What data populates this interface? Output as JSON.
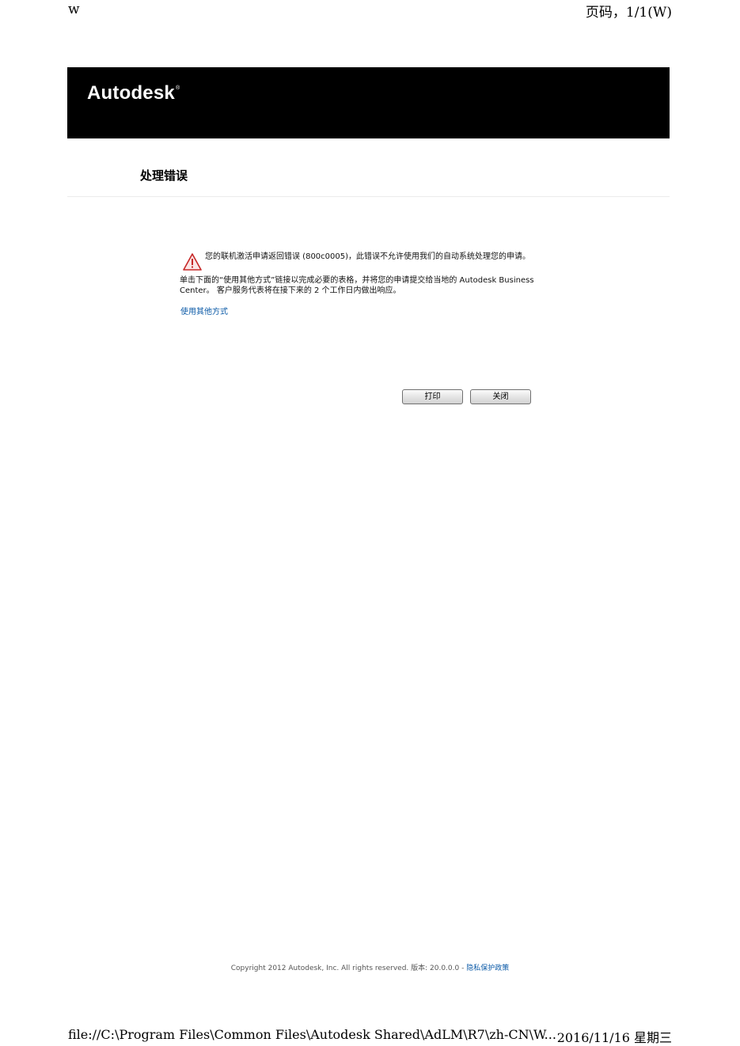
{
  "print_header": {
    "left": "w",
    "right": "页码，1/1(W)"
  },
  "banner": {
    "logo_text": "Autodesk",
    "logo_mark": "®",
    "background_color": "#000000"
  },
  "page": {
    "title": "处理错误"
  },
  "message": {
    "icon": "warning-triangle-icon",
    "line1": "您的联机激活申请返回错误 (800c0005)，此错误不允许使用我们的自动系统处理您的申请。",
    "line2": "单击下面的“使用其他方式”链接以完成必要的表格，并将您的申请提交给当地的 Autodesk Business Center。 客户服务代表将在接下来的 2 个工作日内做出响应。",
    "link_label": "使用其他方式",
    "link_color": "#0b5aa7"
  },
  "buttons": {
    "print_label": "打印",
    "close_label": "关闭"
  },
  "footer": {
    "copyright": "Copyright 2012 Autodesk, Inc. All rights reserved. 版本: 20.0.0.0 -",
    "privacy_label": "隐私保护政策"
  },
  "print_footer": {
    "left": "file://C:\\Program Files\\Common Files\\Autodesk Shared\\AdLM\\R7\\zh-CN\\W...",
    "right": "2016/11/16 星期三"
  }
}
